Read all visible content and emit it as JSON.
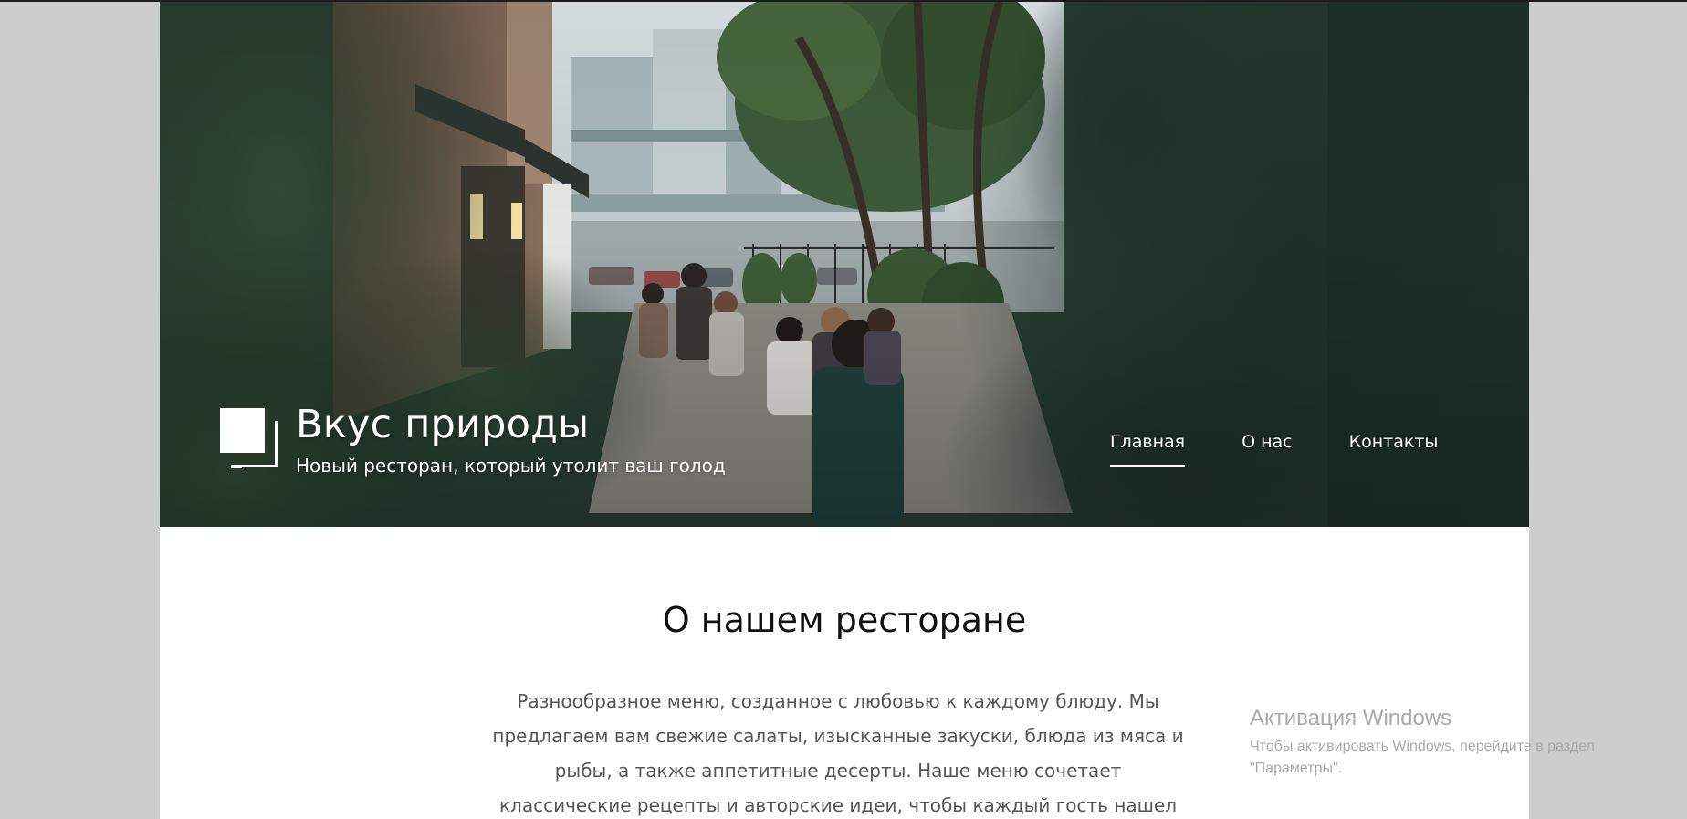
{
  "site": {
    "title": "Вкус природы",
    "tagline": "Новый ресторан, который утолит ваш голод"
  },
  "nav": {
    "items": [
      {
        "label": "Главная",
        "active": true
      },
      {
        "label": "О нас",
        "active": false
      },
      {
        "label": "Контакты",
        "active": false
      }
    ]
  },
  "about": {
    "heading": "О нашем ресторане",
    "text": "Разнообразное меню, созданное с любовью к каждому блюду. Мы предлагаем вам свежие салаты, изысканные закуски, блюда из мяса и рыбы, а также аппетитные десерты. Наше меню сочетает классические рецепты и авторские идеи, чтобы каждый гость нашел что-то по вкусу."
  },
  "watermark": {
    "title": "Активация Windows",
    "subtitle": "Чтобы активировать Windows, перейдите в раздел \"Параметры\"."
  },
  "colors": {
    "page_background": "#cdcdcd",
    "content_background": "#ffffff",
    "nav_text": "#ffffff",
    "heading_text": "#111111",
    "body_text": "#555555",
    "watermark_text": "#a9a9a9"
  },
  "icons": {
    "logo": "two-overlapping-squares-logo"
  }
}
